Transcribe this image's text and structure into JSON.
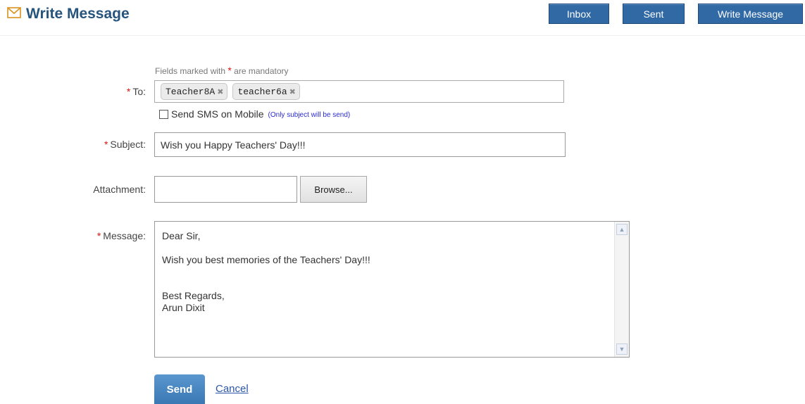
{
  "header": {
    "title": "Write Message",
    "icon": "envelope-icon",
    "nav": {
      "inbox": "Inbox",
      "sent": "Sent",
      "write": "Write Message"
    }
  },
  "form": {
    "mandatory_note_prefix": "Fields marked with ",
    "mandatory_star": "*",
    "mandatory_note_suffix": " are mandatory",
    "to_label": "To:",
    "recipients": [
      "Teacher8A",
      "teacher6a"
    ],
    "recipient_remove_glyph": "✖",
    "sms_label": "Send SMS on Mobile",
    "sms_hint": "(Only subject will be send)",
    "sms_checked": false,
    "subject_label": "Subject:",
    "subject_value": "Wish you Happy Teachers' Day!!!",
    "attachment_label": "Attachment:",
    "attachment_value": "",
    "browse_label": "Browse...",
    "message_label": "Message:",
    "message_value": "Dear Sir,\n\nWish you best memories of the Teachers' Day!!!\n\n\nBest Regards,\nArun Dixit",
    "send_label": "Send",
    "cancel_label": "Cancel"
  },
  "colors": {
    "accent": "#3169a5",
    "title": "#27547c",
    "required": "#dd1111",
    "link": "#2a56a8"
  }
}
